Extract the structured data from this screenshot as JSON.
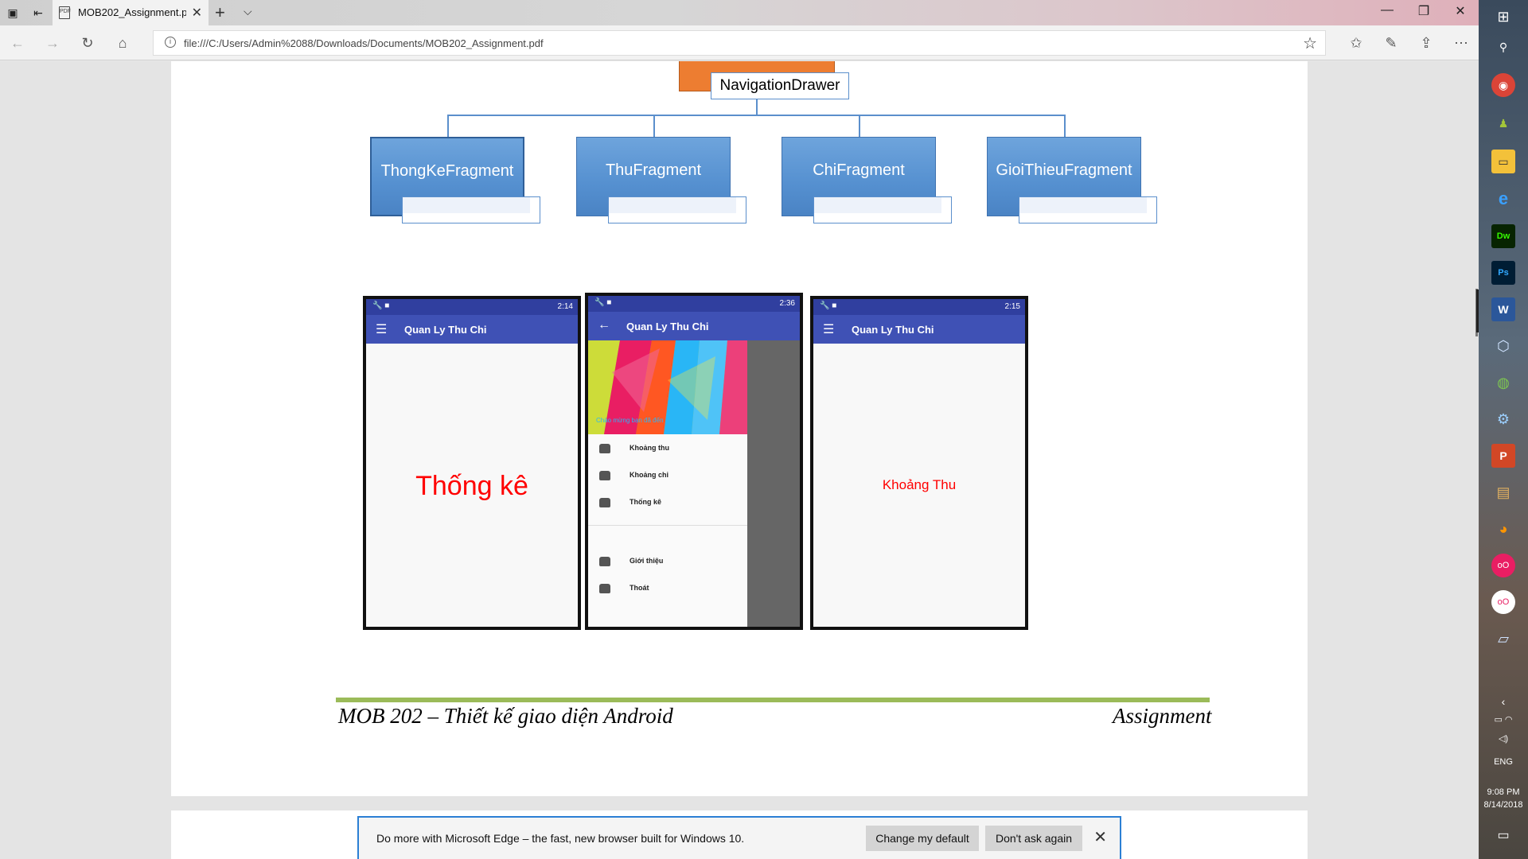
{
  "browser": {
    "tab_title": "MOB202_Assignment.pdf",
    "tab_icon": "pdf-icon",
    "url": "file:///C:/Users/Admin%2088/Downloads/Documents/MOB202_Assignment.pdf"
  },
  "diagram": {
    "root": "NavigationDrawer",
    "children": [
      "ThongKeFragment",
      "ThuFragment",
      "ChiFragment",
      "GioiThieuFragment"
    ]
  },
  "phones": {
    "app_title": "Quan Ly Thu Chi",
    "phone1": {
      "time": "2:14",
      "content": "Thống kê"
    },
    "phone2": {
      "time": "2:36",
      "greeting": "Chào mừng bạn đã đến",
      "menu": [
        "Khoảng thu",
        "Khoảng chi",
        "Thống kê",
        "Giới thiệu",
        "Thoát"
      ]
    },
    "phone3": {
      "time": "2:15",
      "content": "Khoảng Thu"
    }
  },
  "footer": {
    "left": "MOB 202 – Thiết kế giao diện Android",
    "right": "Assignment"
  },
  "notification": {
    "message": "Do more with Microsoft Edge – the fast, new browser built for Windows 10.",
    "change_default": "Change my default",
    "dont_ask": "Don't ask again"
  },
  "taskbar": {
    "language": "ENG",
    "time": "9:08 PM",
    "date": "8/14/2018"
  }
}
